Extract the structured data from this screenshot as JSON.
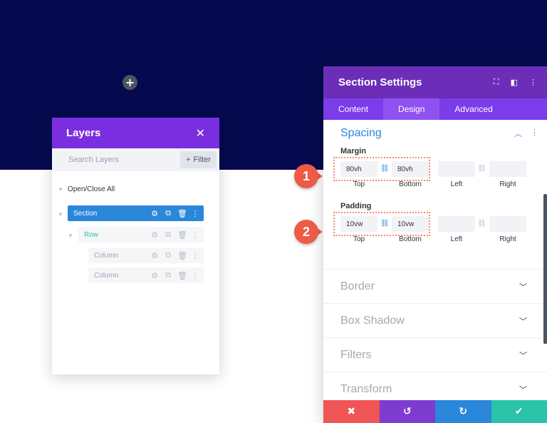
{
  "canvas": {
    "add_icon": "+"
  },
  "layers": {
    "title": "Layers",
    "close_icon": "✕",
    "search_placeholder": "Search Layers",
    "filter_label": "Filter",
    "filter_icon": "+",
    "open_close_all": "Open/Close All",
    "items": [
      {
        "label": "Section",
        "type": "section"
      },
      {
        "label": "Row",
        "type": "row"
      },
      {
        "label": "Column",
        "type": "column"
      },
      {
        "label": "Column",
        "type": "column"
      }
    ]
  },
  "settings": {
    "title": "Section Settings",
    "tabs": [
      "Content",
      "Design",
      "Advanced"
    ],
    "active_tab": "Design",
    "spacing": {
      "title": "Spacing",
      "margin": {
        "label": "Margin",
        "top": "80vh",
        "bottom": "80vh",
        "left": "",
        "right": ""
      },
      "padding": {
        "label": "Padding",
        "top": "10vw",
        "bottom": "10vw",
        "left": "",
        "right": ""
      },
      "sublabels": {
        "top": "Top",
        "bottom": "Bottom",
        "left": "Left",
        "right": "Right"
      }
    },
    "sections": [
      "Border",
      "Box Shadow",
      "Filters",
      "Transform"
    ],
    "footer": {
      "cancel": "✖",
      "undo": "↺",
      "redo": "↻",
      "save": "✔"
    }
  },
  "callouts": [
    "1",
    "2"
  ],
  "colors": {
    "hero_bg": "#050a4f",
    "layers_header": "#7b2ee0",
    "settings_header": "#6c2eb9",
    "accent_blue": "#2b87da",
    "row_green": "#29c4a9",
    "cancel_red": "#ef5555",
    "undo_purple": "#7e3bd0",
    "redo_blue": "#2b87da",
    "save_green": "#29c4a9",
    "callout_red": "#ed5a45"
  }
}
